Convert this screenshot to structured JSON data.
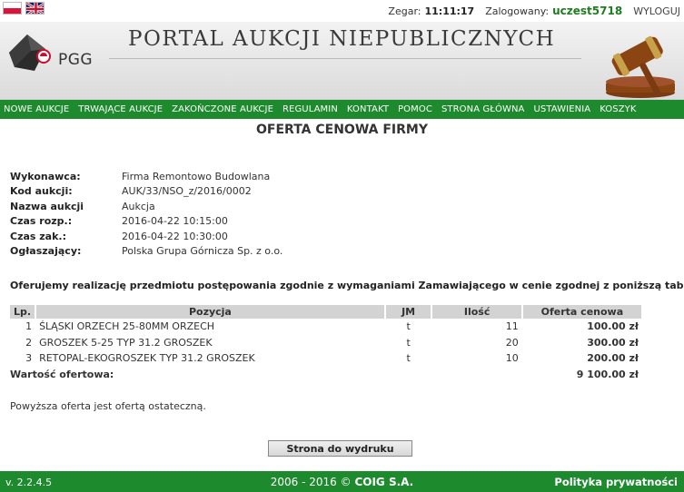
{
  "topbar": {
    "flags": [
      "pl-flag-icon",
      "en-flag-icon"
    ],
    "clock_label": "Zegar:",
    "clock_value": "11:11:17",
    "logged_label": "Zalogowany:",
    "username": "uczest5718",
    "logout_label": "WYLOGUJ"
  },
  "header": {
    "logo_text": "PGG",
    "portal_title": "PORTAL AUKCJI NIEPUBLICZNYCH",
    "gavel_icon": "gavel-icon"
  },
  "nav": {
    "items": [
      {
        "label": "NOWE AUKCJE"
      },
      {
        "label": "TRWAJĄCE AUKCJE"
      },
      {
        "label": "ZAKOŃCZONE AUKCJE"
      },
      {
        "label": "REGULAMIN"
      },
      {
        "label": "KONTAKT"
      },
      {
        "label": "POMOC"
      },
      {
        "label": "STRONA GŁÓWNA"
      },
      {
        "label": "USTAWIENIA"
      },
      {
        "label": "KOSZYK"
      }
    ]
  },
  "page_title": "OFERTA CENOWA FIRMY",
  "details": [
    {
      "key": "Wykonawca:",
      "value": "Firma Remontowo Budowlana"
    },
    {
      "key": "Kod aukcji:",
      "value": "AUK/33/NSO_z/2016/0002"
    },
    {
      "key": "Nazwa aukcji",
      "value": "Aukcja"
    },
    {
      "key": "Czas rozp.:",
      "value": "2016-04-22 10:15:00"
    },
    {
      "key": "Czas zak.:",
      "value": "2016-04-22 10:30:00"
    },
    {
      "key": "Ogłaszający:",
      "value": "Polska Grupa Górnicza Sp. z o.o."
    }
  ],
  "intro": "Oferujemy realizację przedmiotu postępowania zgodnie z wymaganiami Zamawiającego w cenie zgodnej z poniższą tabelą:",
  "table": {
    "headers": {
      "lp": "Lp.",
      "pozycja": "Pozycja",
      "jm": "JM",
      "ilosc": "Ilość",
      "oferta": "Oferta cenowa"
    },
    "rows": [
      {
        "lp": "1",
        "pozycja": "ŚLĄSKI ORZECH 25-80MM ORZECH",
        "jm": "t",
        "ilosc": "11",
        "oferta": "100.00 zł"
      },
      {
        "lp": "2",
        "pozycja": "GROSZEK 5-25 TYP 31.2 GROSZEK",
        "jm": "t",
        "ilosc": "20",
        "oferta": "300.00 zł"
      },
      {
        "lp": "3",
        "pozycja": "RETOPAL-EKOGROSZEK TYP 31.2 GROSZEK",
        "jm": "t",
        "ilosc": "10",
        "oferta": "200.00 zł"
      }
    ],
    "total_label": "Wartość ofertowa:",
    "total_value": "9 100.00 zł"
  },
  "final_note": "Powyższa oferta jest ofertą ostateczną.",
  "print_button": "Strona do wydruku",
  "footer": {
    "version": "v. 2.2.4.5",
    "copyright_years": "2006 - 2016 ©",
    "copyright_company": "COIG S.A.",
    "privacy": "Polityka prywatności"
  },
  "colors": {
    "nav_green": "#1e8a2e",
    "user_green": "#1e7d1e",
    "header_gray": "#e4e4e4"
  }
}
